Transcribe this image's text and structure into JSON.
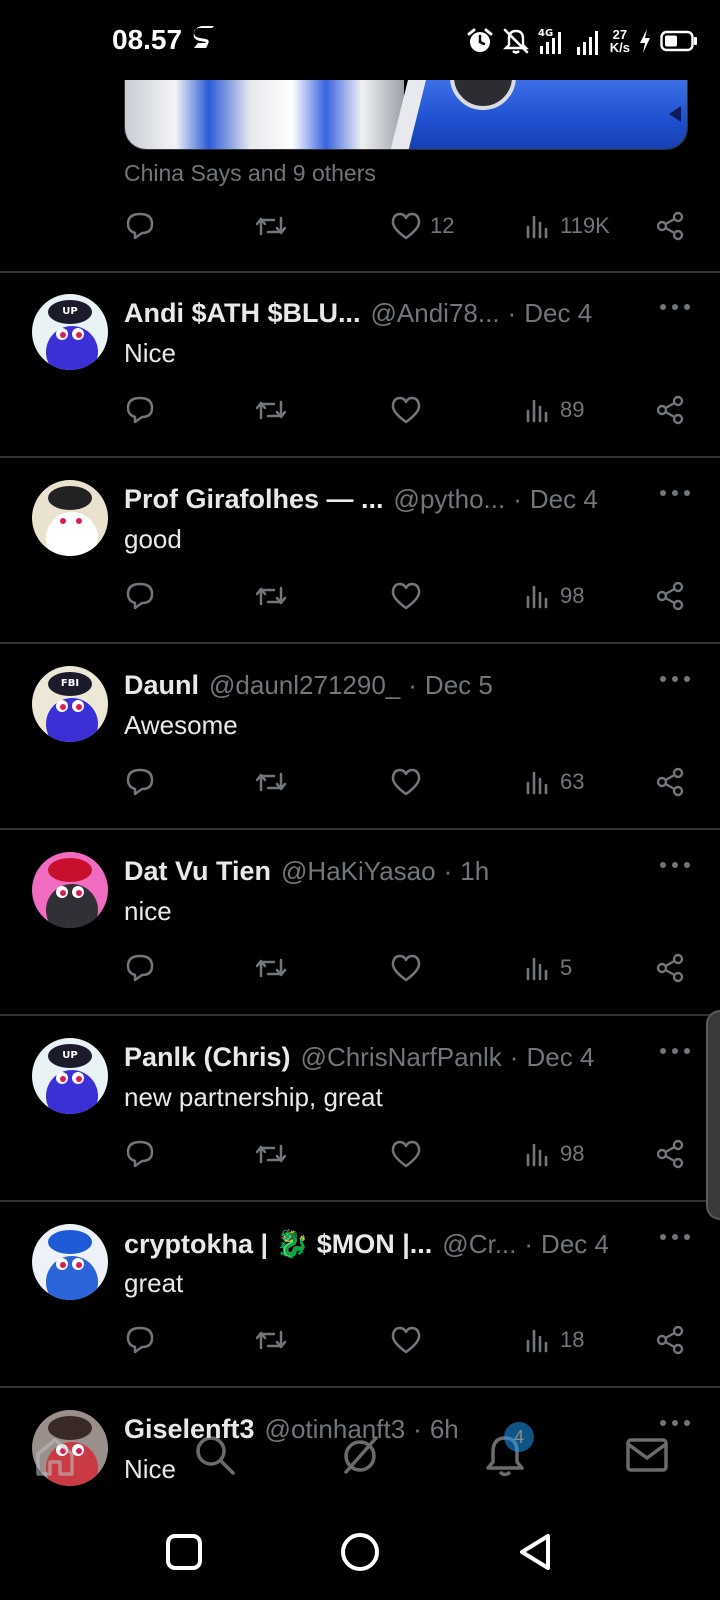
{
  "status_bar": {
    "time": "08.57",
    "net_speed_value": "27",
    "net_speed_unit": "K/s",
    "network_type": "4G",
    "icons": [
      "s-app-icon",
      "alarm-icon",
      "notifications-off-icon",
      "signal-4g-icon",
      "signal-icon",
      "charging-icon",
      "battery-icon"
    ]
  },
  "top_post": {
    "liked_by_text": "China Says and 9 others",
    "like_count": "12",
    "view_count": "119K"
  },
  "replies": [
    {
      "name": "Andi $ATH $BLU...",
      "handle": "@Andi78...",
      "time": "Dec 4",
      "text": "Nice",
      "likes": "",
      "views": "89"
    },
    {
      "name": "Prof Girafolhes — ...",
      "handle": "@pytho...",
      "time": "Dec 4",
      "text": "good",
      "likes": "",
      "views": "98"
    },
    {
      "name": "Daunl",
      "handle": "@daunl271290_",
      "time": "Dec 5",
      "text": "Awesome",
      "likes": "",
      "views": "63"
    },
    {
      "name": "Dat Vu Tien",
      "handle": "@HaKiYasao",
      "time": "1h",
      "text": "nice",
      "likes": "",
      "views": "5"
    },
    {
      "name": "Panlk (Chris)",
      "handle": "@ChrisNarfPanlk",
      "time": "Dec 4",
      "text": "new partnership, great",
      "likes": "",
      "views": "98"
    },
    {
      "name": "cryptokha | 🐉 $MON |...",
      "handle": "@Cr...",
      "time": "Dec 4",
      "text": "great",
      "likes": "",
      "views": "18"
    },
    {
      "name": "Giselenft3",
      "handle": "@otinhanft3",
      "time": "6h",
      "text": "Nice",
      "likes": "",
      "views": ""
    }
  ],
  "bottom_nav": {
    "items": [
      "home-icon",
      "search-icon",
      "grok-icon",
      "notifications-icon",
      "messages-icon"
    ],
    "notification_badge": "4"
  },
  "system_nav": [
    "recents-button",
    "home-button",
    "back-button"
  ],
  "colors": {
    "background": "#000000",
    "text_primary": "#e7e9ea",
    "text_secondary": "#71767b",
    "divider": "#2f3336",
    "accent": "#1d9bf0"
  }
}
